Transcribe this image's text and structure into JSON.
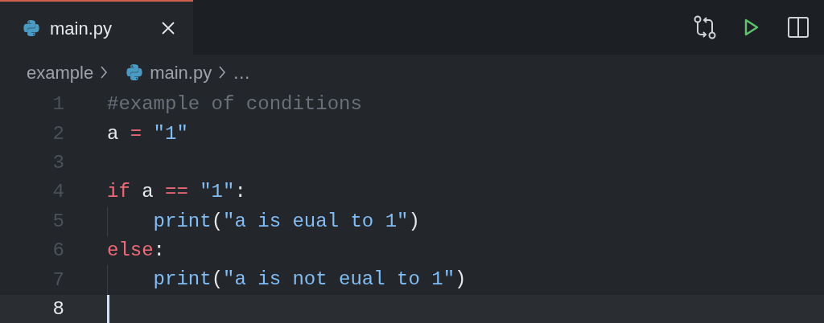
{
  "tabs": [
    {
      "label": "main.py",
      "selected": true
    }
  ],
  "breadcrumb": [
    "example",
    "main.py",
    "…"
  ],
  "lines": [
    {
      "number": "1",
      "current": false,
      "indented": false,
      "tokens": [
        {
          "kind": "comment",
          "text": "#example of conditions"
        }
      ]
    },
    {
      "number": "2",
      "current": false,
      "indented": false,
      "tokens": [
        {
          "kind": "plain",
          "text": "a"
        },
        {
          "kind": "operator",
          "text": "=",
          "space_before": true
        },
        {
          "kind": "string",
          "text": "\"1\"",
          "space_before": true
        }
      ]
    },
    {
      "number": "3",
      "current": false,
      "indented": false
    },
    {
      "number": "4",
      "current": false,
      "indented": false,
      "tokens": [
        {
          "kind": "keyword",
          "text": "if"
        },
        {
          "kind": "plain",
          "text": "a",
          "space_before": true
        },
        {
          "kind": "operator",
          "text": "==",
          "space_before": true
        },
        {
          "kind": "string",
          "text": "\"1\"",
          "space_before": true
        },
        {
          "kind": "plain",
          "text": ":"
        }
      ]
    },
    {
      "number": "5",
      "current": false,
      "indented": true,
      "tokens": [
        {
          "kind": "function",
          "text": "print"
        },
        {
          "kind": "plain",
          "text": "("
        },
        {
          "kind": "string",
          "text": "\"a is eual to 1\""
        },
        {
          "kind": "plain",
          "text": ")"
        }
      ]
    },
    {
      "number": "6",
      "current": false,
      "indented": false,
      "tokens": [
        {
          "kind": "keyword",
          "text": "else"
        },
        {
          "kind": "plain",
          "text": ":"
        }
      ]
    },
    {
      "number": "7",
      "current": false,
      "indented": true,
      "tokens": [
        {
          "kind": "function",
          "text": "print"
        },
        {
          "kind": "plain",
          "text": "("
        },
        {
          "kind": "string",
          "text": "\"a is not eual to 1\""
        },
        {
          "kind": "plain",
          "text": ")"
        }
      ]
    },
    {
      "number": "8",
      "current": true,
      "indented": false
    }
  ]
}
